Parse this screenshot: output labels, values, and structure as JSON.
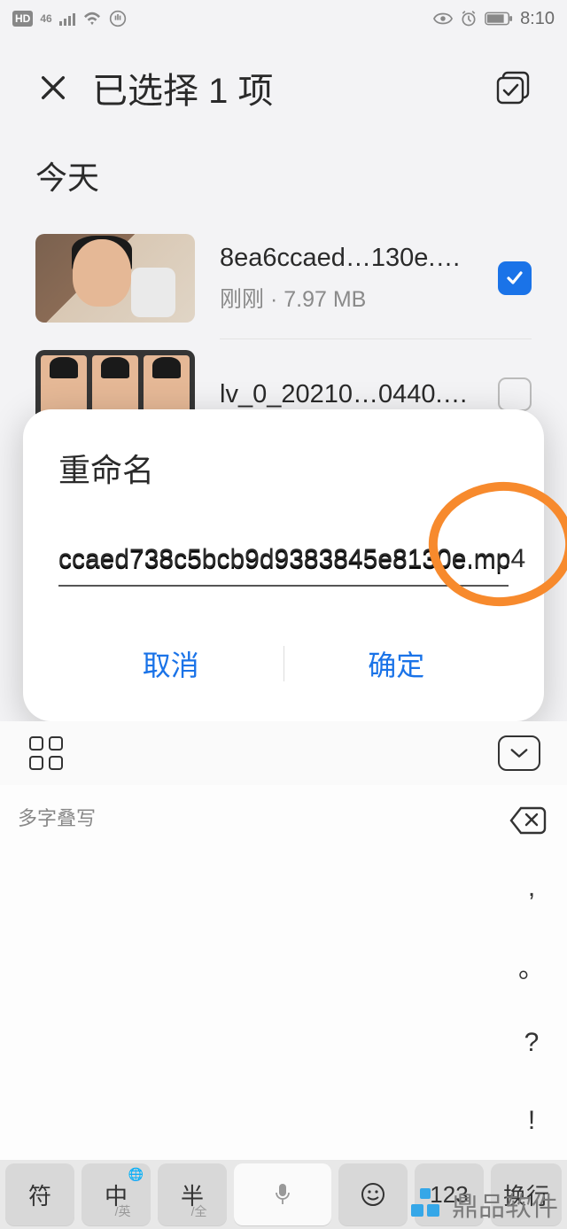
{
  "statusbar": {
    "time": "8:10"
  },
  "header": {
    "title": "已选择 1 项"
  },
  "section": {
    "heading": "今天"
  },
  "files": [
    {
      "name": "8ea6ccaed…130e.mp4",
      "meta": "刚刚 · 7.97 MB",
      "checked": true
    },
    {
      "name": "lv_0_20210…0440.mp4",
      "meta": "",
      "checked": false
    }
  ],
  "dialog": {
    "title": "重命名",
    "value": "ccaed738c5bcb9d9383845e8130e.mp4",
    "cancel": "取消",
    "confirm": "确定"
  },
  "keyboard": {
    "hint": "多字叠写",
    "right": [
      ",",
      "。",
      "?",
      "!"
    ],
    "bottom": {
      "sym": "符",
      "zh": "中",
      "zh_sub": "/英",
      "half": "半",
      "half_sub": "/全",
      "num": "123",
      "enter": "换行"
    }
  },
  "watermark": {
    "text": "鼎品软件"
  }
}
